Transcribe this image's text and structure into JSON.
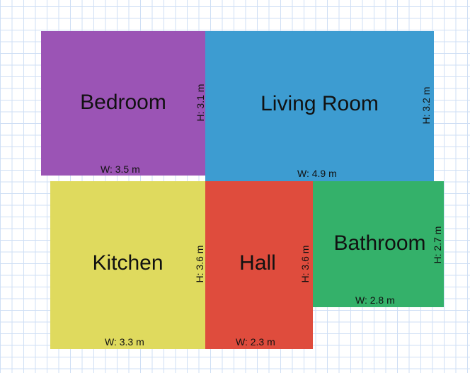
{
  "rooms": {
    "bedroom": {
      "name": "Bedroom",
      "width": "W: 3.5 m",
      "height": "H: 3.1 m",
      "color": "#9b54b5"
    },
    "living_room": {
      "name": "Living Room",
      "width": "W: 4.9 m",
      "height": "H: 3.2 m",
      "color": "#3d9cd1"
    },
    "kitchen": {
      "name": "Kitchen",
      "width": "W: 3.3 m",
      "height": "H: 3.6 m",
      "color": "#dfda5e"
    },
    "hall": {
      "name": "Hall",
      "width": "W: 2.3 m",
      "height": "H: 3.6 m",
      "color": "#df4c3d"
    },
    "bathroom": {
      "name": "Bathroom",
      "width": "W: 2.8 m",
      "height": "H: 2.7 m",
      "color": "#34b16a"
    }
  }
}
